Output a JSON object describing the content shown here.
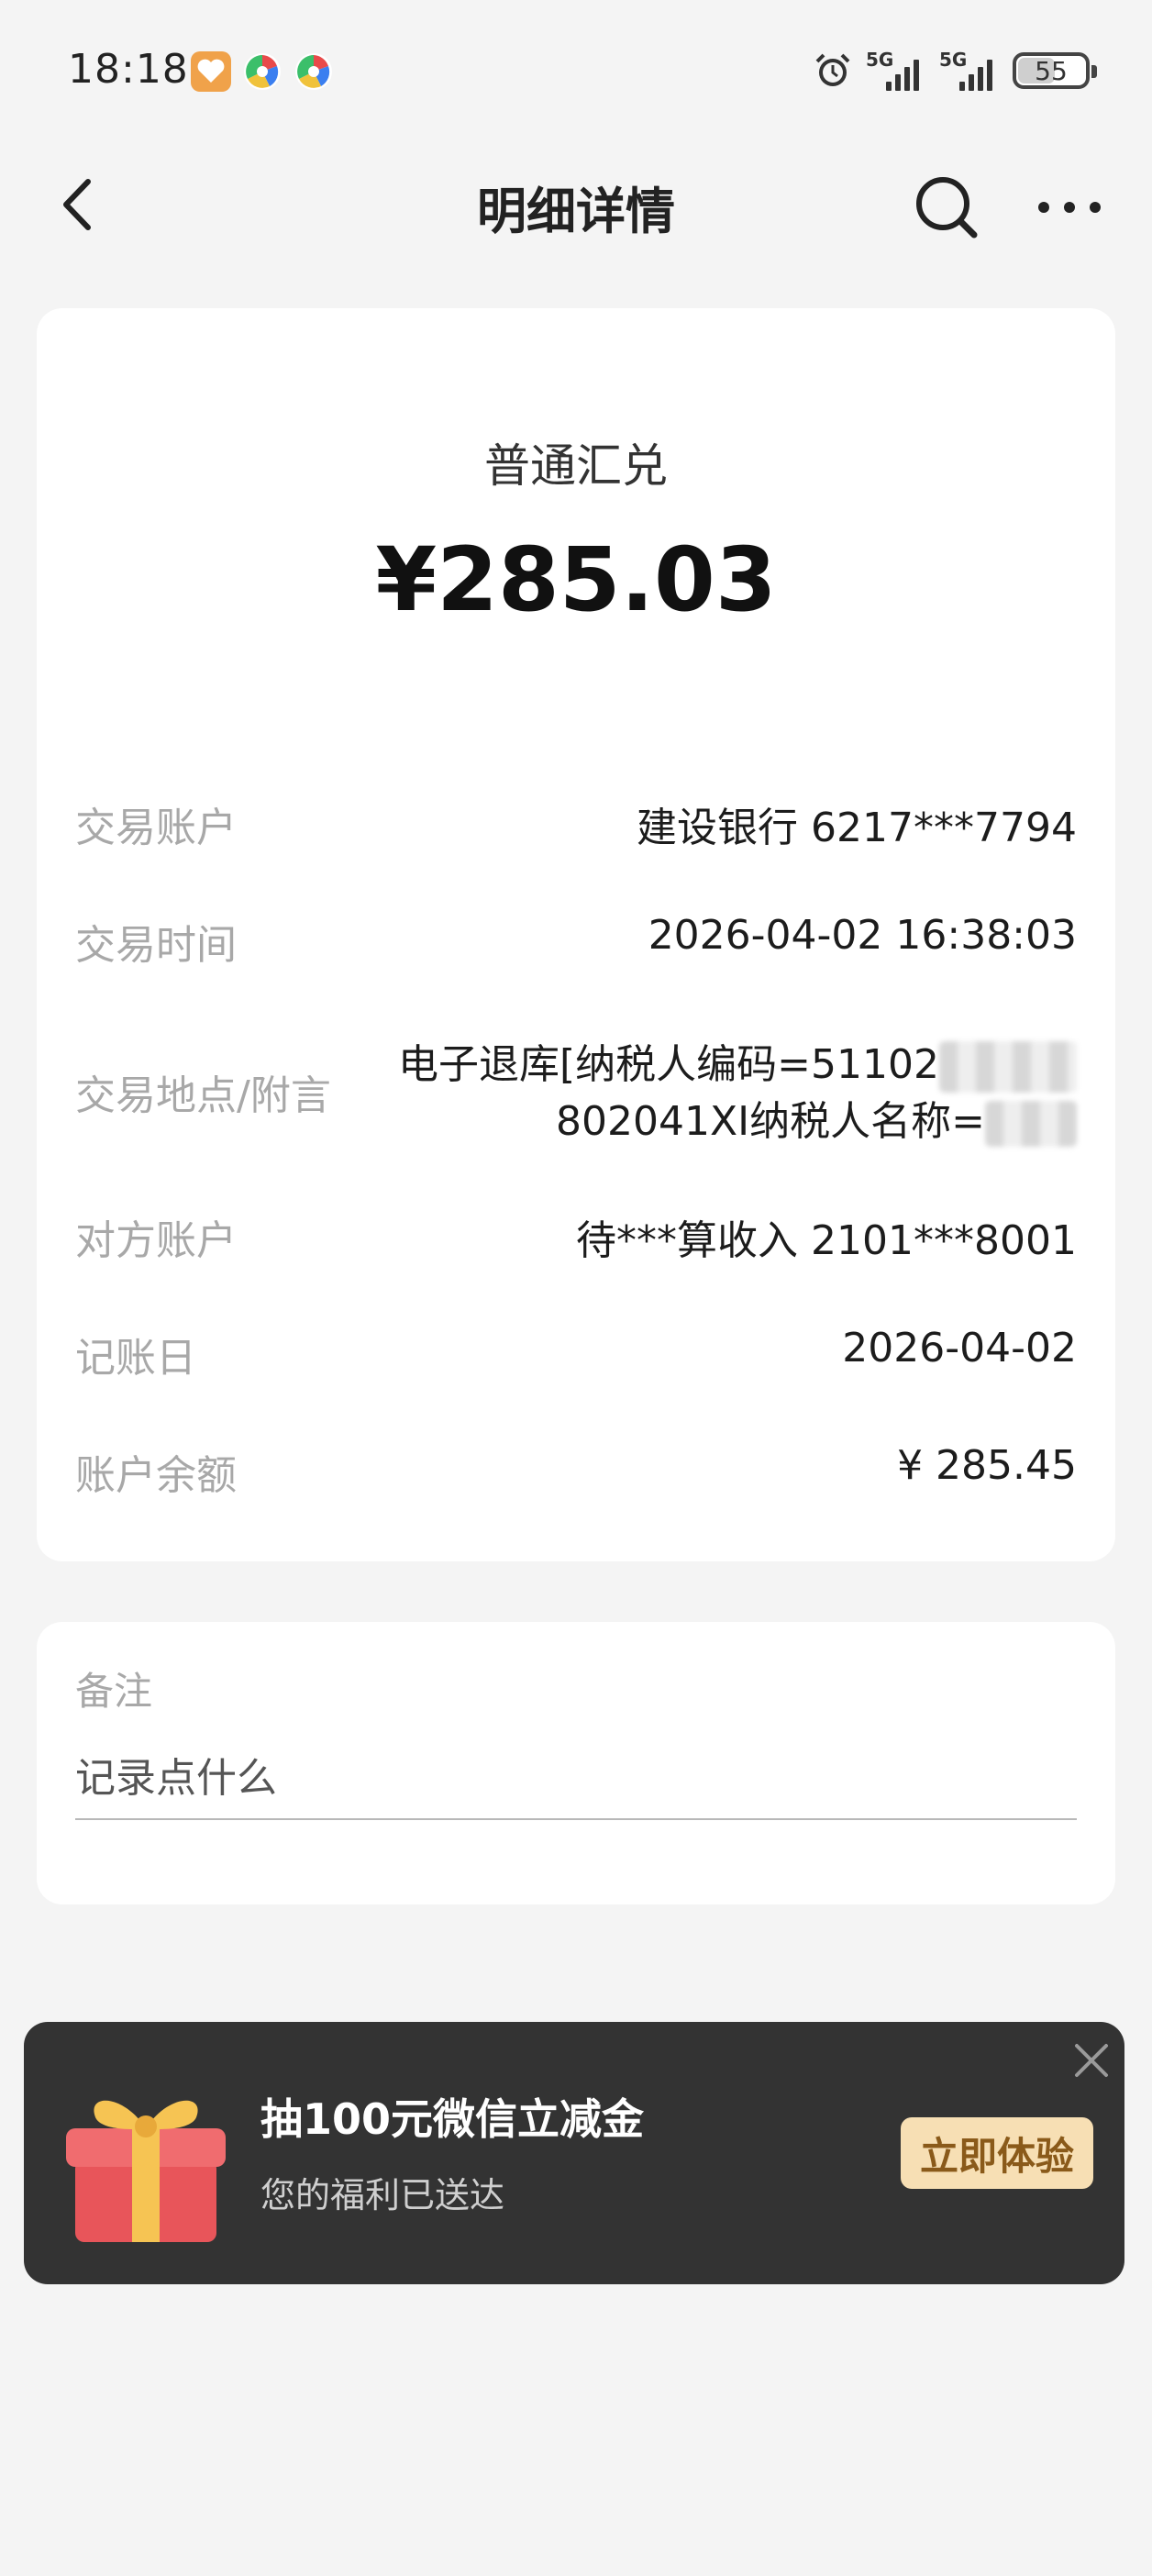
{
  "status_bar": {
    "time": "18:18",
    "network_1": "5G",
    "network_2": "5G",
    "battery": "55",
    "battery_level": 0.55,
    "icons": [
      "health-app-icon",
      "pinwheel-app-icon",
      "pinwheel-app-icon",
      "alarm-icon",
      "signal-icon",
      "signal-icon",
      "battery-icon"
    ]
  },
  "header": {
    "title": "明细详情",
    "back_icon": "chevron-left-icon",
    "search_icon": "search-icon",
    "more_icon": "more-dots-icon"
  },
  "transaction": {
    "type": "普通汇兑",
    "amount": "¥285.03"
  },
  "details": [
    {
      "label": "交易账户",
      "value": "建设银行 6217***7794"
    },
    {
      "label": "交易时间",
      "value": "2026-04-02 16:38:03"
    },
    {
      "label": "交易地点/附言",
      "value_line1": "电子退库[纳税人编码=51102",
      "value_line2": "802041XI纳税人名称="
    },
    {
      "label": "对方账户",
      "value": "待***算收入 2101***8001"
    },
    {
      "label": "记账日",
      "value": "2026-04-02"
    },
    {
      "label": "账户余额",
      "value": "¥ 285.45"
    }
  ],
  "note": {
    "label": "备注",
    "placeholder": "记录点什么"
  },
  "promo": {
    "title": "抽100元微信立减金",
    "subtitle": "您的福利已送达",
    "cta": "立即体验",
    "gift_icon": "gift-box-icon",
    "close_icon": "close-icon"
  }
}
